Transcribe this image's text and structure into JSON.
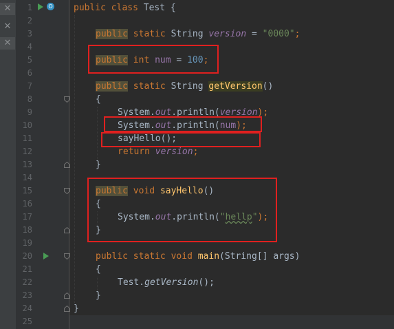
{
  "editor": {
    "line_numbers": [
      "1",
      "2",
      "3",
      "4",
      "5",
      "6",
      "7",
      "8",
      "9",
      "10",
      "11",
      "12",
      "13",
      "14",
      "15",
      "16",
      "17",
      "18",
      "19",
      "20",
      "21",
      "22",
      "23",
      "24",
      "25"
    ],
    "lines": {
      "l1": {
        "kw1": "public",
        "kw2": "class",
        "t": "Test {"
      },
      "l3": {
        "kw": "public",
        "kw2": "static",
        "type": "String",
        "field": "version",
        "eq": " = ",
        "str": "\"0000\"",
        "end": ";"
      },
      "l5": {
        "kw": "public",
        "kw2": "int",
        "field": "num",
        "eq": " = ",
        "num": "100",
        "end": ";"
      },
      "l7": {
        "kw": "public",
        "kw2": "static",
        "type": "String",
        "method": "getVersion",
        "end": "()"
      },
      "l8": {
        "t": "{"
      },
      "l9": {
        "a": "System.",
        "b": "out",
        "c": ".println(",
        "d": "version",
        "e": ");"
      },
      "l10": {
        "a": "System.",
        "b": "out",
        "c": ".println(",
        "d": "num",
        "e": ");"
      },
      "l11": {
        "t": "sayHello();"
      },
      "l12": {
        "kw": "return",
        "field": "version",
        "end": ";"
      },
      "l13": {
        "t": "}"
      },
      "l15": {
        "kw": "public",
        "kw2": "void",
        "method": "sayHello",
        "end": "()"
      },
      "l16": {
        "t": "{"
      },
      "l17": {
        "a": "System.",
        "b": "out",
        "c": ".println(",
        "q1": "\"",
        "word": "hellp",
        "q2": "\"",
        "e": ");"
      },
      "l18": {
        "t": "}"
      },
      "l20": {
        "kw": "public",
        "kw2": "static",
        "kw3": "void",
        "method": "main",
        "args": "(String[] args)"
      },
      "l21": {
        "t": "{"
      },
      "l22": {
        "a": "Test.",
        "b": "getVersion",
        "c": "();"
      },
      "l23": {
        "t": "}"
      },
      "l24": {
        "t": "}"
      }
    }
  },
  "colors": {
    "background": "#2b2b2b",
    "gutter": "#313335",
    "keyword": "#cc7832",
    "field": "#9876aa",
    "number": "#6897bb",
    "string": "#6a8759",
    "method": "#ffc66d",
    "annotation": "#e0201f"
  },
  "icons": [
    "close-icon",
    "run-icon",
    "override-icon",
    "fold-icon"
  ]
}
